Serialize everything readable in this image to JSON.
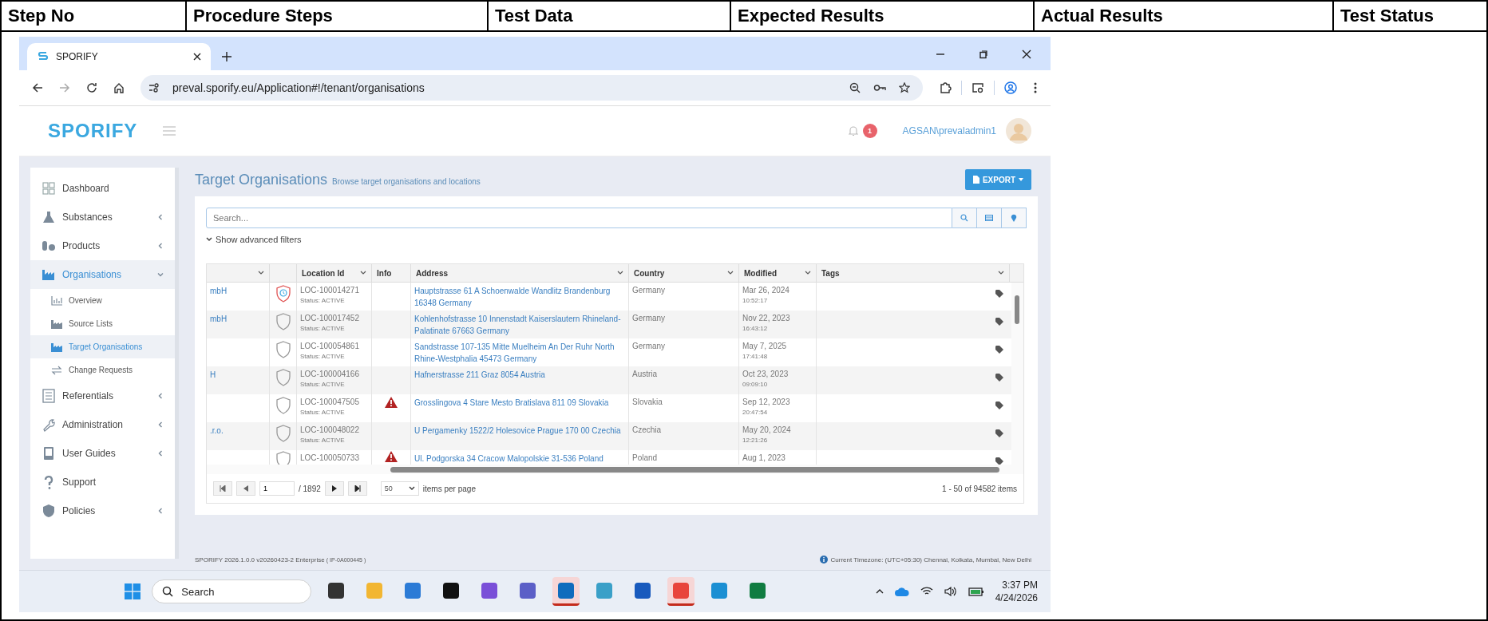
{
  "document_table": {
    "columns": [
      "Step No",
      "Procedure Steps",
      "Test Data",
      "Expected Results",
      "Actual Results",
      "Test Status"
    ]
  },
  "browser": {
    "tab_title": "SPORIFY",
    "url": "preval.sporify.eu/Application#!/tenant/organisations"
  },
  "app": {
    "logo": "SPORIFY",
    "notification_count": "1",
    "user": "AGSAN\\prevaladmin1"
  },
  "sidebar": [
    {
      "label": "Dashboard",
      "kind": "link",
      "expanded": false
    },
    {
      "label": "Substances",
      "kind": "group",
      "expanded": false
    },
    {
      "label": "Products",
      "kind": "group",
      "expanded": false
    },
    {
      "label": "Organisations",
      "kind": "group",
      "expanded": true,
      "children": [
        {
          "label": "Overview",
          "selected": false
        },
        {
          "label": "Source Lists",
          "selected": false
        },
        {
          "label": "Target Organisations",
          "selected": true
        },
        {
          "label": "Change Requests",
          "selected": false
        }
      ]
    },
    {
      "label": "Referentials",
      "kind": "group",
      "expanded": false
    },
    {
      "label": "Administration",
      "kind": "group",
      "expanded": false
    },
    {
      "label": "User Guides",
      "kind": "group",
      "expanded": false
    },
    {
      "label": "Support",
      "kind": "link",
      "expanded": false
    },
    {
      "label": "Policies",
      "kind": "group",
      "expanded": false
    }
  ],
  "page": {
    "title": "Target Organisations",
    "subtitle": "Browse target organisations and locations",
    "export_label": "EXPORT"
  },
  "search": {
    "placeholder": "Search..."
  },
  "advanced_filters": "Show advanced filters",
  "table": {
    "columns": [
      {
        "menu": true
      },
      {
        "menu": false
      },
      {
        "label": "Location Id",
        "menu": true
      },
      {
        "label": "Info",
        "menu": false
      },
      {
        "label": "Address",
        "menu": true
      },
      {
        "label": "Country",
        "menu": true
      },
      {
        "label": "Modified",
        "menu": true
      },
      {
        "label": "Tags",
        "menu": true
      }
    ],
    "rows": [
      {
        "org": "mbH",
        "flagged": true,
        "warning": false,
        "location_id": "LOC-100014271",
        "status": "Status: ACTIVE",
        "address": "Hauptstrasse 61 A Schoenwalde Wandlitz Brandenburg 16348 Germany",
        "country": "Germany",
        "modified_date": "Mar 26, 2024",
        "modified_time": "10:52:17"
      },
      {
        "org": "mbH",
        "flagged": false,
        "warning": false,
        "location_id": "LOC-100017452",
        "status": "Status: ACTIVE",
        "address": "Kohlenhofstrasse 10 Innenstadt Kaiserslautern Rhineland-Palatinate 67663 Germany",
        "country": "Germany",
        "modified_date": "Nov 22, 2023",
        "modified_time": "16:43:12"
      },
      {
        "flagged": false,
        "warning": false,
        "location_id": "LOC-100054861",
        "status": "Status: ACTIVE",
        "address": "Sandstrasse 107-135 Mitte Muelheim An Der Ruhr North Rhine-Westphalia 45473 Germany",
        "country": "Germany",
        "modified_date": "May 7, 2025",
        "modified_time": "17:41:48"
      },
      {
        "org": "H",
        "flagged": false,
        "warning": false,
        "location_id": "LOC-100004166",
        "status": "Status: ACTIVE",
        "address": "Hafnerstrasse 211 Graz 8054 Austria",
        "country": "Austria",
        "modified_date": "Oct 23, 2023",
        "modified_time": "09:09:10"
      },
      {
        "flagged": false,
        "warning": true,
        "location_id": "LOC-100047505",
        "status": "Status: ACTIVE",
        "address": "Grosslingova 4 Stare Mesto Bratislava 811 09 Slovakia",
        "country": "Slovakia",
        "modified_date": "Sep 12, 2023",
        "modified_time": "20:47:54"
      },
      {
        "org": ".r.o.",
        "flagged": false,
        "warning": false,
        "location_id": "LOC-100048022",
        "status": "Status: ACTIVE",
        "address": "U Pergamenky 1522/2 Holesovice Prague 170 00 Czechia",
        "country": "Czechia",
        "modified_date": "May 20, 2024",
        "modified_time": "12:21:26"
      },
      {
        "flagged": false,
        "warning": true,
        "location_id": "LOC-100050733",
        "address": "Ul. Podgorska 34 Cracow Malopolskie 31-536 Poland",
        "country": "Poland",
        "modified_date": "Aug 1, 2023"
      }
    ]
  },
  "pagination": {
    "page": "1",
    "total_pages": "/ 1892",
    "page_size": "50",
    "page_size_label": "items per page",
    "summary": "1 - 50 of 94582 items"
  },
  "footer": {
    "version": "SPORIFY 2026.1.0.0 v20260423-2 Enterprise",
    "build": "( IP-0A000445 )",
    "timezone": "Current Timezone: (UTC+05:30) Chennai, Kolkata, Mumbai, New Delhi"
  },
  "taskbar": {
    "search_placeholder": "Search",
    "apps": [
      {
        "selected": false
      },
      {
        "selected": false
      },
      {
        "selected": false
      },
      {
        "selected": false
      },
      {
        "selected": false
      },
      {
        "selected": false
      },
      {
        "selected": true
      },
      {
        "selected": false
      },
      {
        "selected": false
      },
      {
        "selected": true
      },
      {
        "selected": false
      },
      {
        "selected": false
      }
    ],
    "time": "3:37 PM",
    "date": "4/24/2026"
  }
}
